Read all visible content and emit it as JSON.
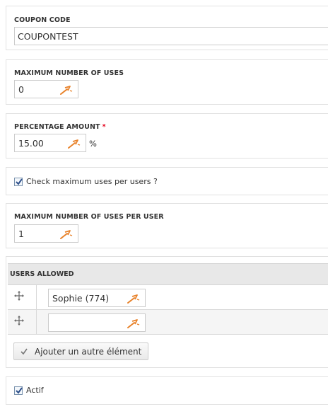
{
  "coupon_code": {
    "label": "COUPON CODE",
    "value": "COUPONTEST"
  },
  "max_uses": {
    "label": "MAXIMUM NUMBER OF USES",
    "value": "0"
  },
  "percentage": {
    "label": "PERCENTAGE AMOUNT",
    "required_mark": "*",
    "value": "15.00",
    "unit": "%"
  },
  "check_per_user": {
    "label": "Check maximum uses per users ?",
    "checked": true
  },
  "max_uses_per_user": {
    "label": "MAXIMUM NUMBER OF USES PER USER",
    "value": "1"
  },
  "users_allowed": {
    "header": "USERS ALLOWED",
    "rows": [
      {
        "value": "Sophie (774)"
      },
      {
        "value": ""
      }
    ],
    "add_button_label": "Ajouter un autre élément"
  },
  "actif": {
    "label": "Actif",
    "checked": true
  },
  "colors": {
    "accent_wand": "#e8822a",
    "required": "#e4001b",
    "checkbox_border": "#7b93ae"
  }
}
